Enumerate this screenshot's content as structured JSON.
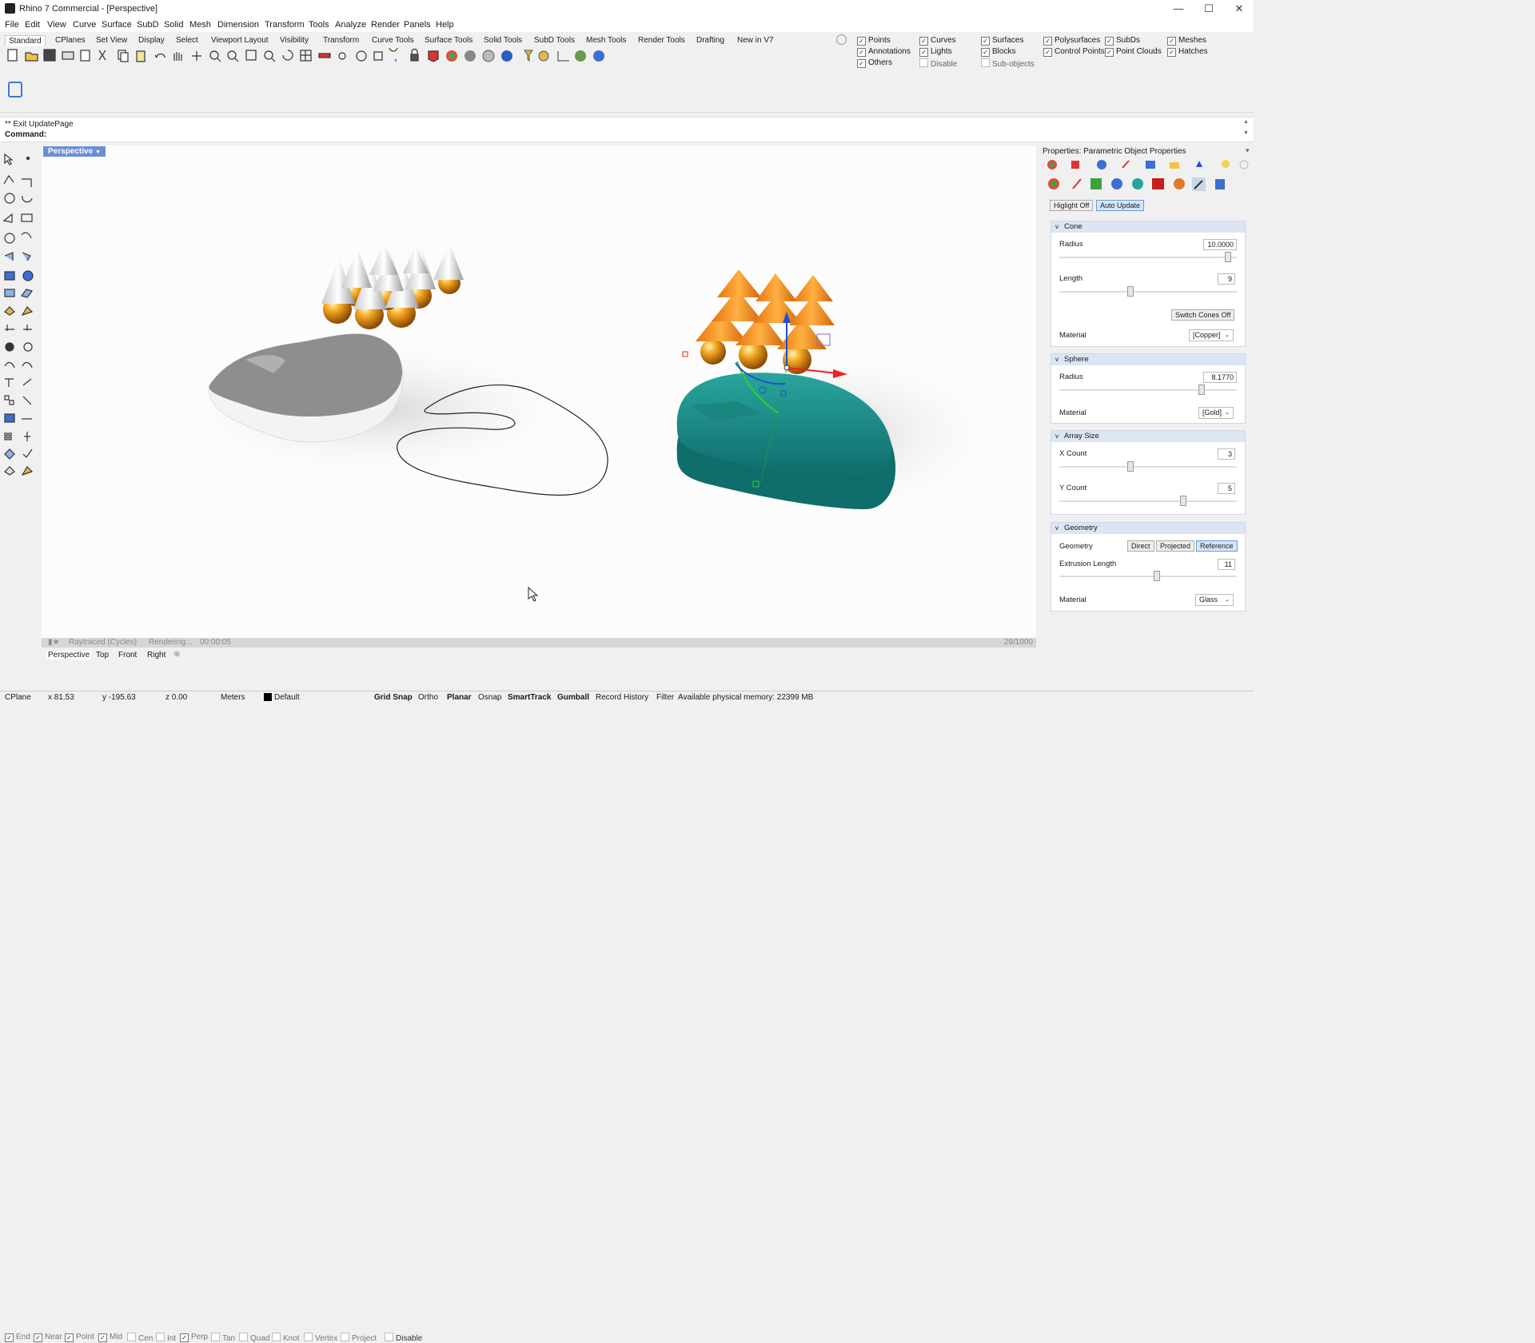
{
  "window": {
    "title": "Rhino 7 Commercial - [Perspective]",
    "minimize": "—",
    "maximize": "☐",
    "close": "✕"
  },
  "menu": [
    "File",
    "Edit",
    "View",
    "Curve",
    "Surface",
    "SubD",
    "Solid",
    "Mesh",
    "Dimension",
    "Transform",
    "Tools",
    "Analyze",
    "Render",
    "Panels",
    "Help"
  ],
  "toolbar_tabs": [
    "Standard",
    "CPlanes",
    "Set View",
    "Display",
    "Select",
    "Viewport Layout",
    "Visibility",
    "Transform",
    "Curve Tools",
    "Surface Tools",
    "Solid Tools",
    "SubD Tools",
    "Mesh Tools",
    "Render Tools",
    "Drafting",
    "New in V7"
  ],
  "filters": {
    "points": "Points",
    "curves": "Curves",
    "surfaces": "Surfaces",
    "polysurfaces": "Polysurfaces",
    "subds": "SubDs",
    "meshes": "Meshes",
    "annotations": "Annotations",
    "lights": "Lights",
    "blocks": "Blocks",
    "control_points": "Control Points",
    "point_clouds": "Point Clouds",
    "hatches": "Hatches",
    "others": "Others",
    "disable": "Disable",
    "sub_objects": "Sub-objects"
  },
  "command": {
    "history": "** Exit UpdatePage",
    "prompt": "Command:"
  },
  "viewport": {
    "label": "Perspective",
    "render_mode": "Raytraced (Cycles)",
    "render_status": "Rendering...",
    "render_time": "00:00:05",
    "render_progress": "29/1000",
    "tabs": [
      "Perspective",
      "Top",
      "Front",
      "Right"
    ],
    "add_tab": "⊕"
  },
  "properties": {
    "title": "Properties: Parametric Object Properties",
    "highlight_btn": "Higlight Off",
    "auto_update_btn": "Auto Update",
    "cone": {
      "header": "Cone",
      "radius_label": "Radius",
      "radius_value": "10.0000",
      "length_label": "Length",
      "length_value": "9",
      "switch_btn": "Switch Cones Off",
      "material_label": "Material",
      "material_value": "[Copper]",
      "radius_level": 0.95,
      "length_level": 0.4
    },
    "sphere": {
      "header": "Sphere",
      "radius_label": "Radius",
      "radius_value": "8.1770",
      "material_label": "Material",
      "material_value": "[Gold]",
      "radius_level": 0.8
    },
    "array": {
      "header": "Array Size",
      "x_label": "X Count",
      "x_value": "3",
      "y_label": "Y Count",
      "y_value": "5",
      "x_level": 0.4,
      "y_level": 0.7
    },
    "geometry": {
      "header": "Geometry",
      "geometry_label": "Geometry",
      "direct_btn": "Direct",
      "projected_btn": "Projected",
      "reference_btn": "Reference",
      "extrusion_label": "Extrusion Length",
      "extrusion_value": "11",
      "material_label": "Material",
      "material_value": "Glass",
      "extrusion_level": 0.55
    }
  },
  "osnaps": [
    {
      "label": "End",
      "on": true
    },
    {
      "label": "Near",
      "on": true
    },
    {
      "label": "Point",
      "on": true
    },
    {
      "label": "Mid",
      "on": true
    },
    {
      "label": "Cen",
      "on": false
    },
    {
      "label": "Int",
      "on": false
    },
    {
      "label": "Perp",
      "on": true
    },
    {
      "label": "Tan",
      "on": false
    },
    {
      "label": "Quad",
      "on": false
    },
    {
      "label": "Knot",
      "on": false
    },
    {
      "label": "Vertex",
      "on": false
    },
    {
      "label": "Project",
      "on": false
    },
    {
      "label": "Disable",
      "on": false
    }
  ],
  "status": {
    "cplane": "CPlane",
    "x": "x 81.53",
    "y": "y -195.63",
    "z": "z 0.00",
    "units": "Meters",
    "layer": "Default",
    "grid_snap": "Grid Snap",
    "ortho": "Ortho",
    "planar": "Planar",
    "osnap": "Osnap",
    "smarttrack": "SmartTrack",
    "gumball": "Gumball",
    "record_history": "Record History",
    "filter": "Filter",
    "memory": "Available physical memory: 22399 MB"
  },
  "colors": {
    "accent": "#6b8fd6",
    "teal": "#1f8a86",
    "copper": "#f08a1c",
    "gold": "#e8a21a"
  }
}
